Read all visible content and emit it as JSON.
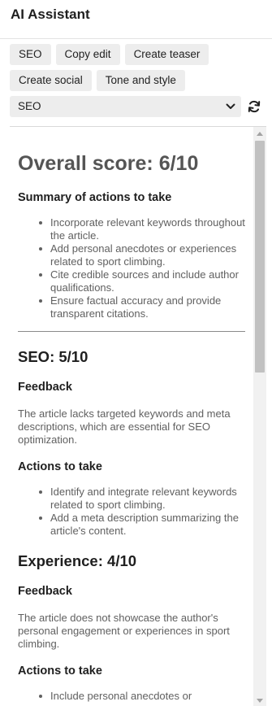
{
  "app": {
    "title": "AI Assistant"
  },
  "toolbar": {
    "row1": [
      "SEO",
      "Copy edit",
      "Create teaser"
    ],
    "row2": [
      "Create social",
      "Tone and style"
    ],
    "select_value": "SEO"
  },
  "report": {
    "overall_score": "Overall score: 6/10",
    "summary_heading": "Summary of actions to take",
    "summary_items": [
      "Incorporate relevant keywords throughout the article.",
      "Add personal anecdotes or experiences related to sport climbing.",
      "Cite credible sources and include author qualifications.",
      "Ensure factual accuracy and provide transparent citations."
    ],
    "seo": {
      "heading": "SEO: 5/10",
      "feedback_heading": "Feedback",
      "feedback": "The article lacks targeted keywords and meta descriptions, which are essential for SEO optimization.",
      "actions_heading": "Actions to take",
      "actions": [
        "Identify and integrate relevant keywords related to sport climbing.",
        "Add a meta description summarizing the article's content."
      ]
    },
    "experience": {
      "heading": "Experience: 4/10",
      "feedback_heading": "Feedback",
      "feedback": "The article does not showcase the author's personal engagement or experiences in sport climbing.",
      "actions_heading": "Actions to take",
      "actions": [
        "Include personal anecdotes or"
      ]
    }
  }
}
